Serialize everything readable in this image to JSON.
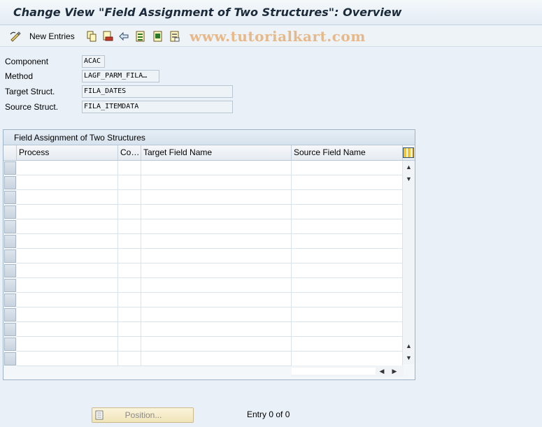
{
  "window": {
    "title": "Change View \"Field Assignment of Two Structures\": Overview"
  },
  "toolbar": {
    "new_entries_label": "New Entries",
    "watermark": "www.tutorialkart.com",
    "icons": [
      "change-display-icon",
      "copy-icon",
      "delete-icon",
      "undo-icon",
      "select-all-icon",
      "select-block-icon",
      "deselect-all-icon"
    ]
  },
  "header_fields": [
    {
      "label": "Component",
      "value": "ACAC"
    },
    {
      "label": "Method",
      "value": "LAGF_PARM_FILA…"
    },
    {
      "label": "Target Struct.",
      "value": "FILA_DATES"
    },
    {
      "label": "Source Struct.",
      "value": "FILA_ITEMDATA"
    }
  ],
  "table": {
    "title": "Field Assignment of Two Structures",
    "columns": [
      "Process",
      "Co…",
      "Target Field Name",
      "Source Field Name"
    ],
    "rows": []
  },
  "footer": {
    "position_label": "Position...",
    "entry_info": "Entry 0 of 0"
  },
  "colors": {
    "background": "#e9f0f7",
    "title_text": "#1b2a3a",
    "watermark": "#e7b98a",
    "position_button": "#f1e4b8"
  }
}
